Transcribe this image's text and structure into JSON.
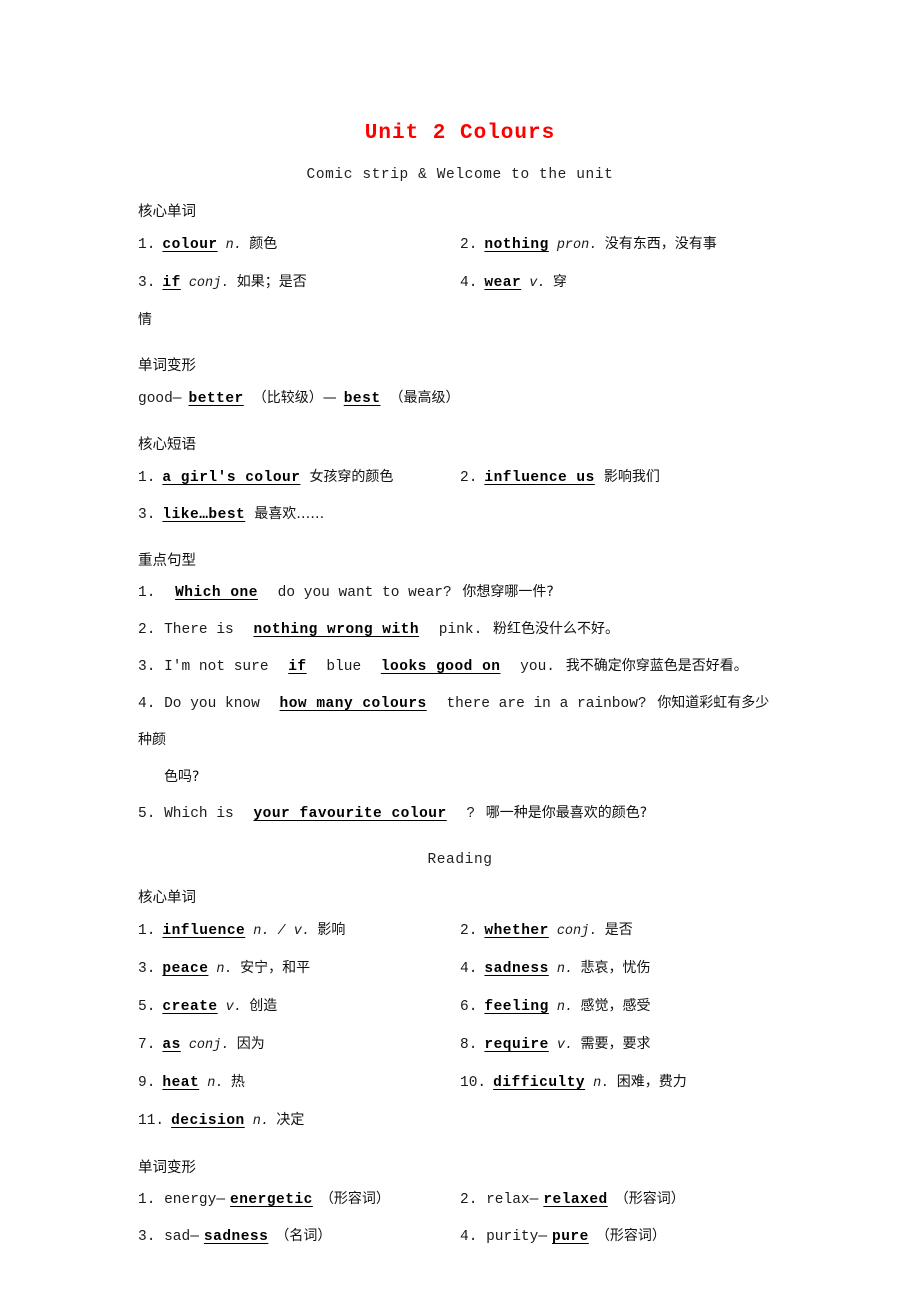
{
  "title": "Unit 2  Colours",
  "banners": {
    "comic": "Comic strip & Welcome to the unit",
    "reading": "Reading"
  },
  "headings": {
    "core_words": "核心单词",
    "word_forms": "单词变形",
    "core_phrases": "核心短语",
    "key_sentences": "重点句型"
  },
  "comic": {
    "core_words": [
      {
        "num": "1.",
        "answer": "colour",
        "pos": "n.",
        "cn": "颜色"
      },
      {
        "num": "2.",
        "answer": "nothing",
        "pos": "pron.",
        "cn": "没有东西，没有事"
      },
      {
        "num": "3.",
        "answer": "if",
        "pos": "conj.",
        "cn": "如果；是否"
      },
      {
        "num": "4.",
        "answer": "wear",
        "pos": "v.",
        "cn": "穿"
      }
    ],
    "core_words_overflow": "情",
    "word_forms_line": {
      "base": "good—",
      "answer1": "better",
      "label1": "（比较级）—",
      "answer2": "best",
      "label2": "（最高级）"
    },
    "core_phrases": [
      {
        "num": "1.",
        "answer": "a girl's colour",
        "cn": "女孩穿的颜色"
      },
      {
        "num": "2.",
        "answer": "influence us",
        "cn": "影响我们"
      },
      {
        "num": "3.",
        "answer": "like…best",
        "cn": "最喜欢……"
      }
    ],
    "key_sentences": [
      {
        "num": "1.",
        "parts": [
          {
            "type": "blank",
            "text": "Which one"
          },
          {
            "type": "en",
            "text": "do you want to wear?"
          },
          {
            "type": "cn",
            "text": "你想穿哪一件?"
          }
        ]
      },
      {
        "num": "2.",
        "parts": [
          {
            "type": "en",
            "text": "There is"
          },
          {
            "type": "blank",
            "text": "nothing wrong with"
          },
          {
            "type": "en",
            "text": "pink."
          },
          {
            "type": "cn",
            "text": "粉红色没什么不好。"
          }
        ]
      },
      {
        "num": "3.",
        "parts": [
          {
            "type": "en",
            "text": "I'm not sure"
          },
          {
            "type": "blank",
            "text": "if"
          },
          {
            "type": "en",
            "text": "blue"
          },
          {
            "type": "blank",
            "text": "looks good on"
          },
          {
            "type": "en",
            "text": "you."
          },
          {
            "type": "cn",
            "text": "我不确定你穿蓝色是否好看。"
          }
        ]
      },
      {
        "num": "4.",
        "parts": [
          {
            "type": "en",
            "text": "Do you know"
          },
          {
            "type": "blank",
            "text": "how many colours"
          },
          {
            "type": "en",
            "text": "there are in a rainbow?"
          },
          {
            "type": "cn",
            "text": "你知道彩虹有多少种颜"
          }
        ],
        "continuation": "色吗?"
      },
      {
        "num": "5.",
        "parts": [
          {
            "type": "en",
            "text": "Which is"
          },
          {
            "type": "blank",
            "text": "your favourite colour"
          },
          {
            "type": "en",
            "text": "?"
          },
          {
            "type": "cn",
            "text": "哪一种是你最喜欢的颜色?"
          }
        ]
      }
    ]
  },
  "reading": {
    "core_words": [
      {
        "num": "1.",
        "answer": "influence",
        "pos": "n. / v.",
        "cn": "影响"
      },
      {
        "num": "2.",
        "answer": "whether",
        "pos": "conj.",
        "cn": "是否"
      },
      {
        "num": "3.",
        "answer": "peace",
        "pos": "n.",
        "cn": "安宁，和平"
      },
      {
        "num": "4.",
        "answer": "sadness",
        "pos": "n.",
        "cn": "悲哀，忧伤"
      },
      {
        "num": "5.",
        "answer": "create",
        "pos": "v.",
        "cn": "创造"
      },
      {
        "num": "6.",
        "answer": "feeling",
        "pos": "n.",
        "cn": "感觉，感受"
      },
      {
        "num": "7.",
        "answer": "as",
        "pos": "conj.",
        "cn": "因为"
      },
      {
        "num": "8.",
        "answer": "require",
        "pos": "v.",
        "cn": "需要，要求"
      },
      {
        "num": "9.",
        "answer": "heat",
        "pos": "n.",
        "cn": "热"
      },
      {
        "num": "10.",
        "answer": "difficulty",
        "pos": "n.",
        "cn": "困难，费力"
      },
      {
        "num": "11.",
        "answer": "decision",
        "pos": "n.",
        "cn": "决定"
      }
    ],
    "word_forms": [
      {
        "num": "1.",
        "base": "energy—",
        "answer": "energetic",
        "label": "（形容词）"
      },
      {
        "num": "2.",
        "base": "relax—",
        "answer": "relaxed",
        "label": "（形容词）"
      },
      {
        "num": "3.",
        "base": "sad—",
        "answer": "sadness",
        "label": "（名词）"
      },
      {
        "num": "4.",
        "base": "purity—",
        "answer": "pure",
        "label": "（形容词）"
      }
    ]
  },
  "colors": {
    "title_red": "#ff0000",
    "body_text": "#1a1a1a",
    "background": "#ffffff"
  }
}
